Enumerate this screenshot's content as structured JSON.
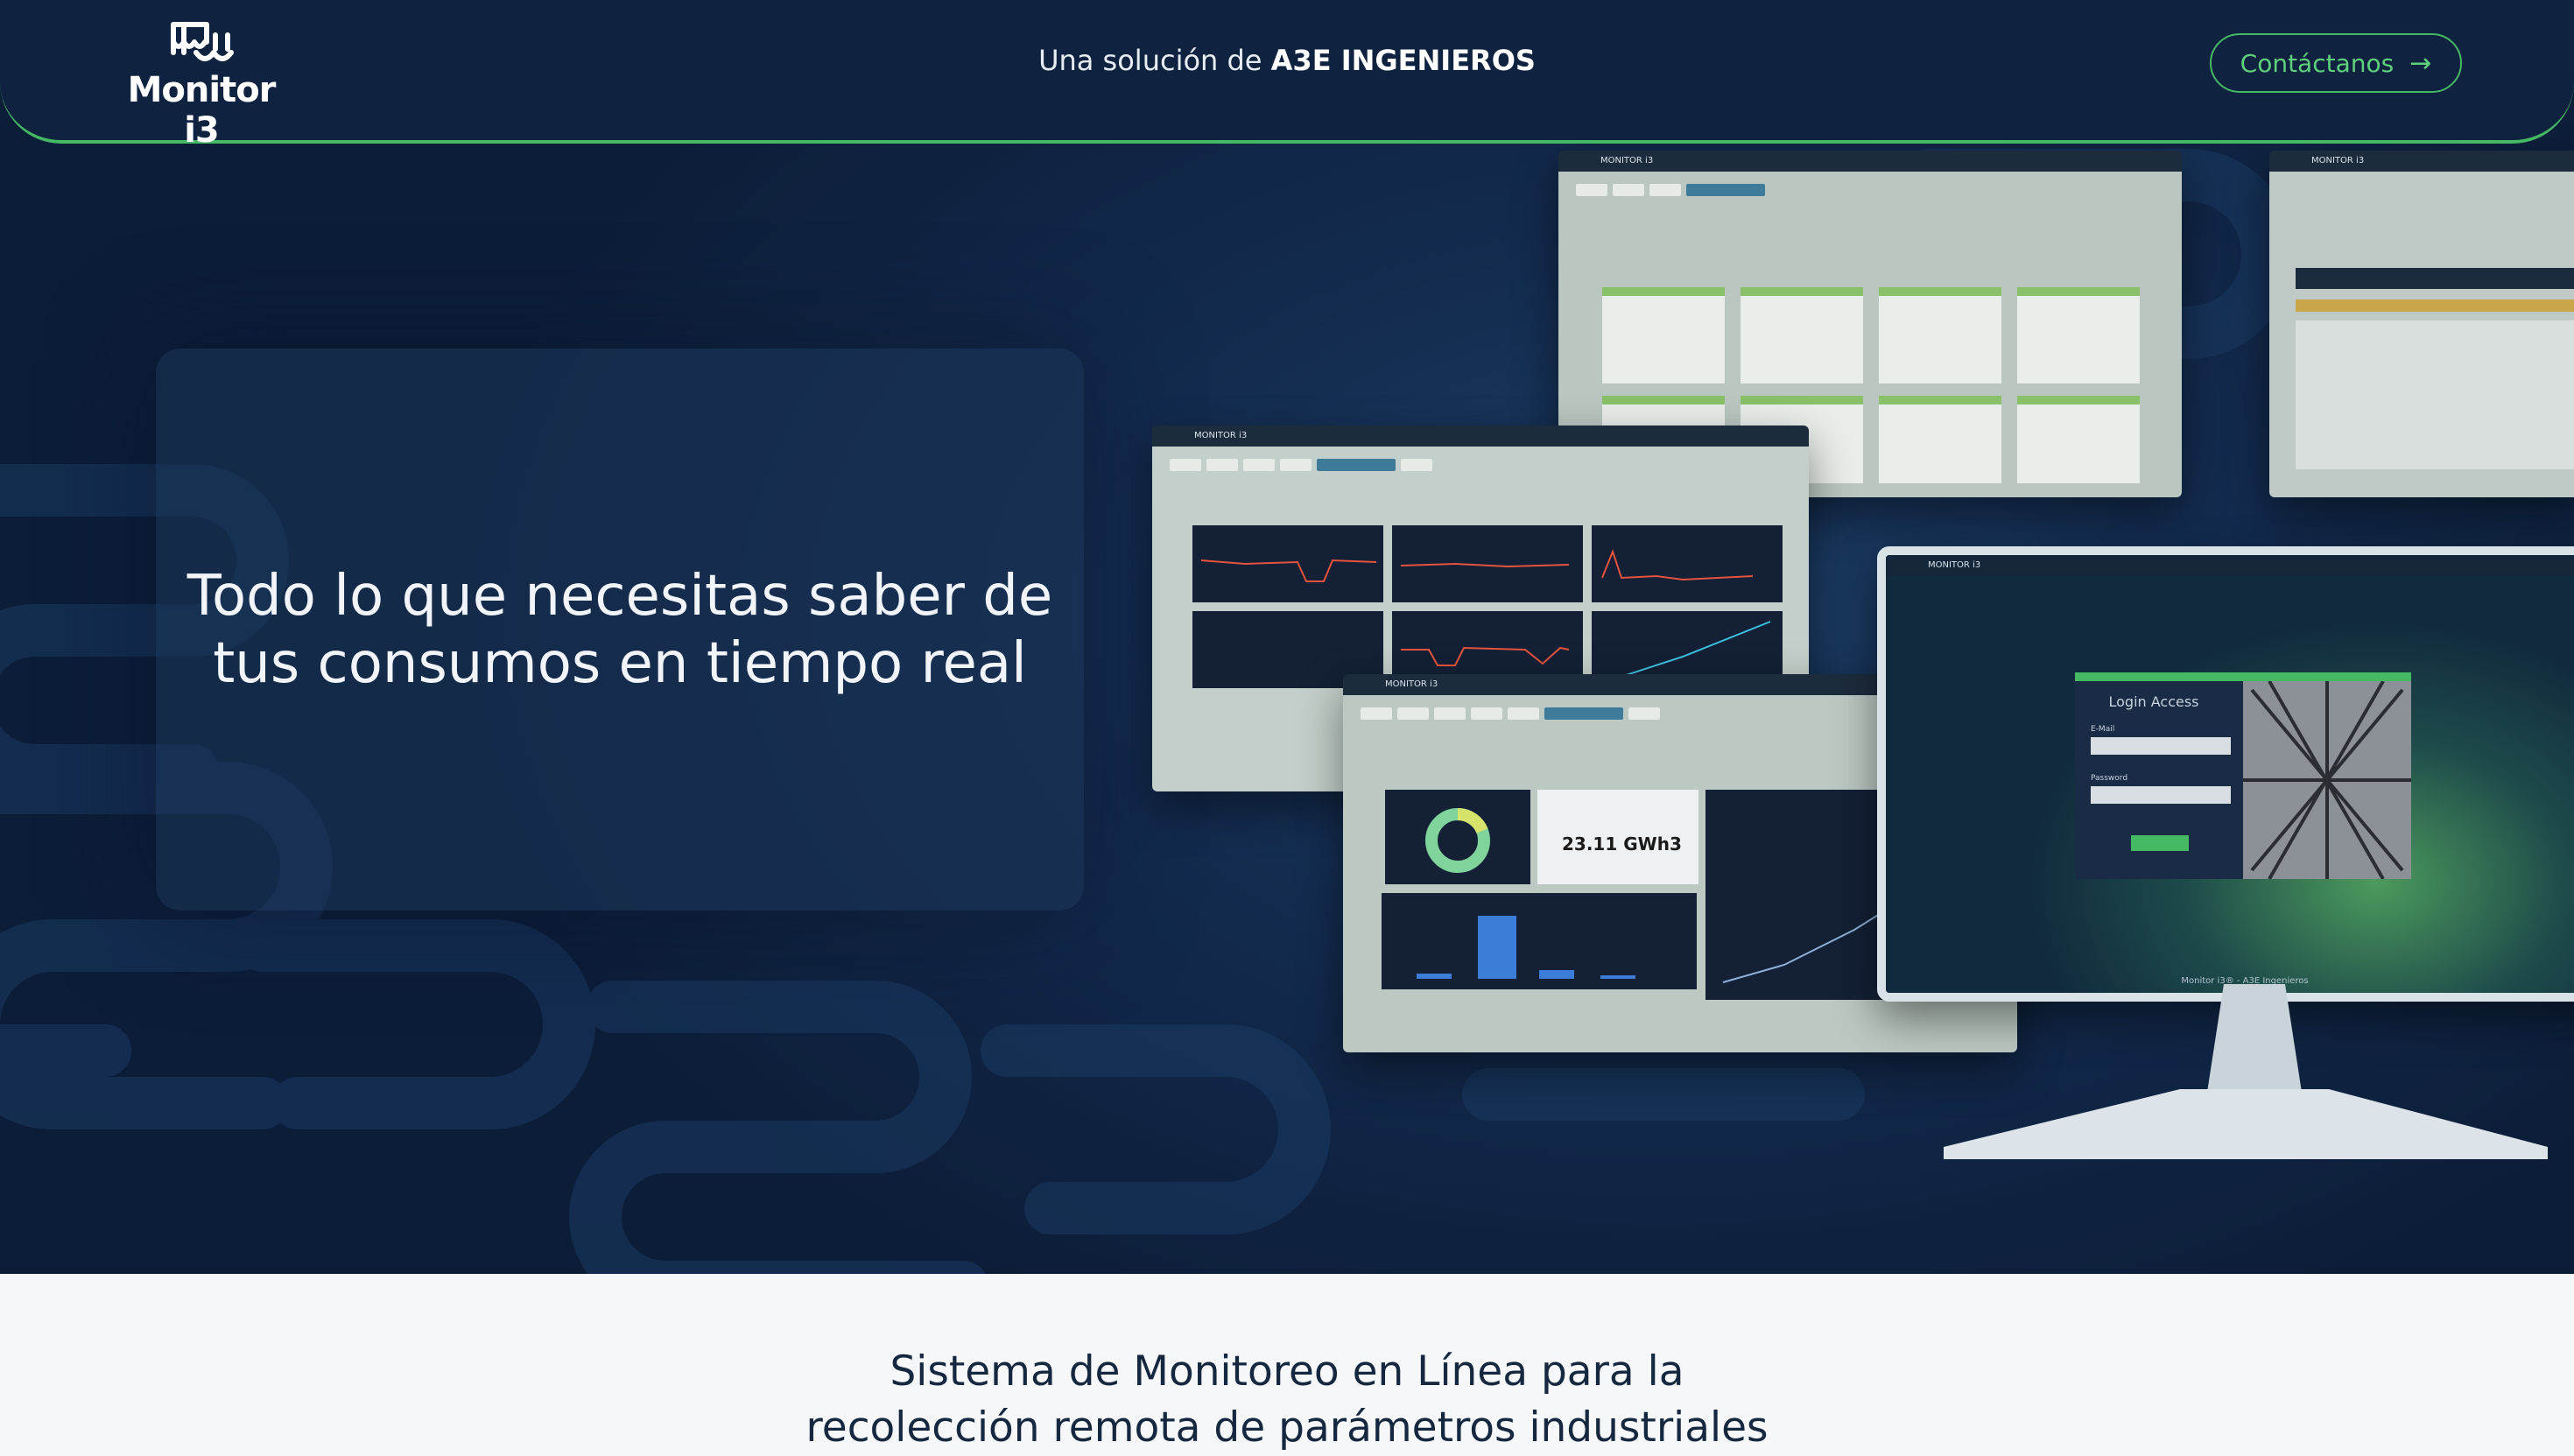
{
  "header": {
    "logo_text": "Monitor i3",
    "tagline_prefix": "Una solución de",
    "tagline_brand": "A3E INGENIEROS",
    "contact_label": "Contáctanos",
    "contact_icon": "arrow-right-icon"
  },
  "hero": {
    "title": "Todo lo que necesitas saber de tus consumos en tiempo real",
    "screens": {
      "app_title": "MONITOR i3",
      "kpi_value": "23.11 GWh3",
      "login_title": "Login Access",
      "login_email_label": "E-Mail",
      "login_password_label": "Password",
      "login_footer": "Monitor i3® - A3E Ingenieros"
    }
  },
  "section": {
    "title_line1": "Sistema de Monitoreo en Línea para la",
    "title_line2": "recolección remota de parámetros industriales"
  },
  "colors": {
    "navy": "#0f2340",
    "accent_green": "#45b864",
    "text_light": "#f1f4f8"
  }
}
